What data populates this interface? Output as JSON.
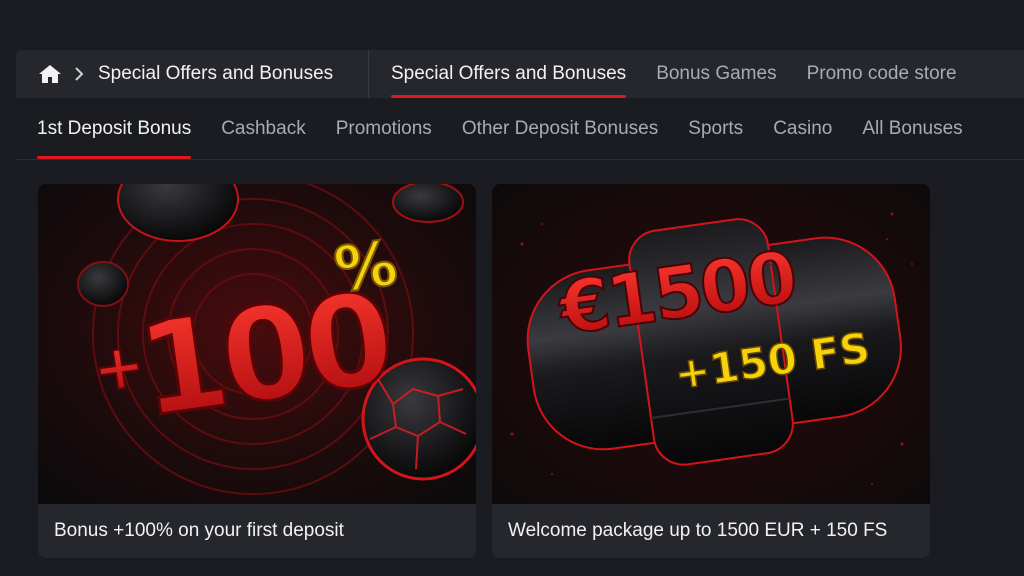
{
  "breadcrumb": {
    "home_icon": "home-icon",
    "separator_icon": "chevron-right-icon",
    "current": "Special Offers and Bonuses"
  },
  "top_tabs": [
    {
      "label": "Special Offers and Bonuses",
      "active": true
    },
    {
      "label": "Bonus Games",
      "active": false
    },
    {
      "label": "Promo code store",
      "active": false
    }
  ],
  "sub_tabs": [
    {
      "label": "1st Deposit Bonus",
      "active": true
    },
    {
      "label": "Cashback",
      "active": false
    },
    {
      "label": "Promotions",
      "active": false
    },
    {
      "label": "Other Deposit Bonuses",
      "active": false
    },
    {
      "label": "Sports",
      "active": false
    },
    {
      "label": "Casino",
      "active": false
    },
    {
      "label": "All Bonuses",
      "active": false
    }
  ],
  "cards": [
    {
      "image_text_main": "+100",
      "image_text_suffix": "%",
      "title": "Bonus +100% on your first deposit"
    },
    {
      "image_text_main": "€1500",
      "image_text_sub": "+150 FS",
      "title": "Welcome package up to 1500 EUR + 150 FS"
    }
  ],
  "colors": {
    "accent": "#e0171d",
    "background": "#1a1c21",
    "panel": "#25272d",
    "highlight_yellow": "#f5d20c"
  }
}
